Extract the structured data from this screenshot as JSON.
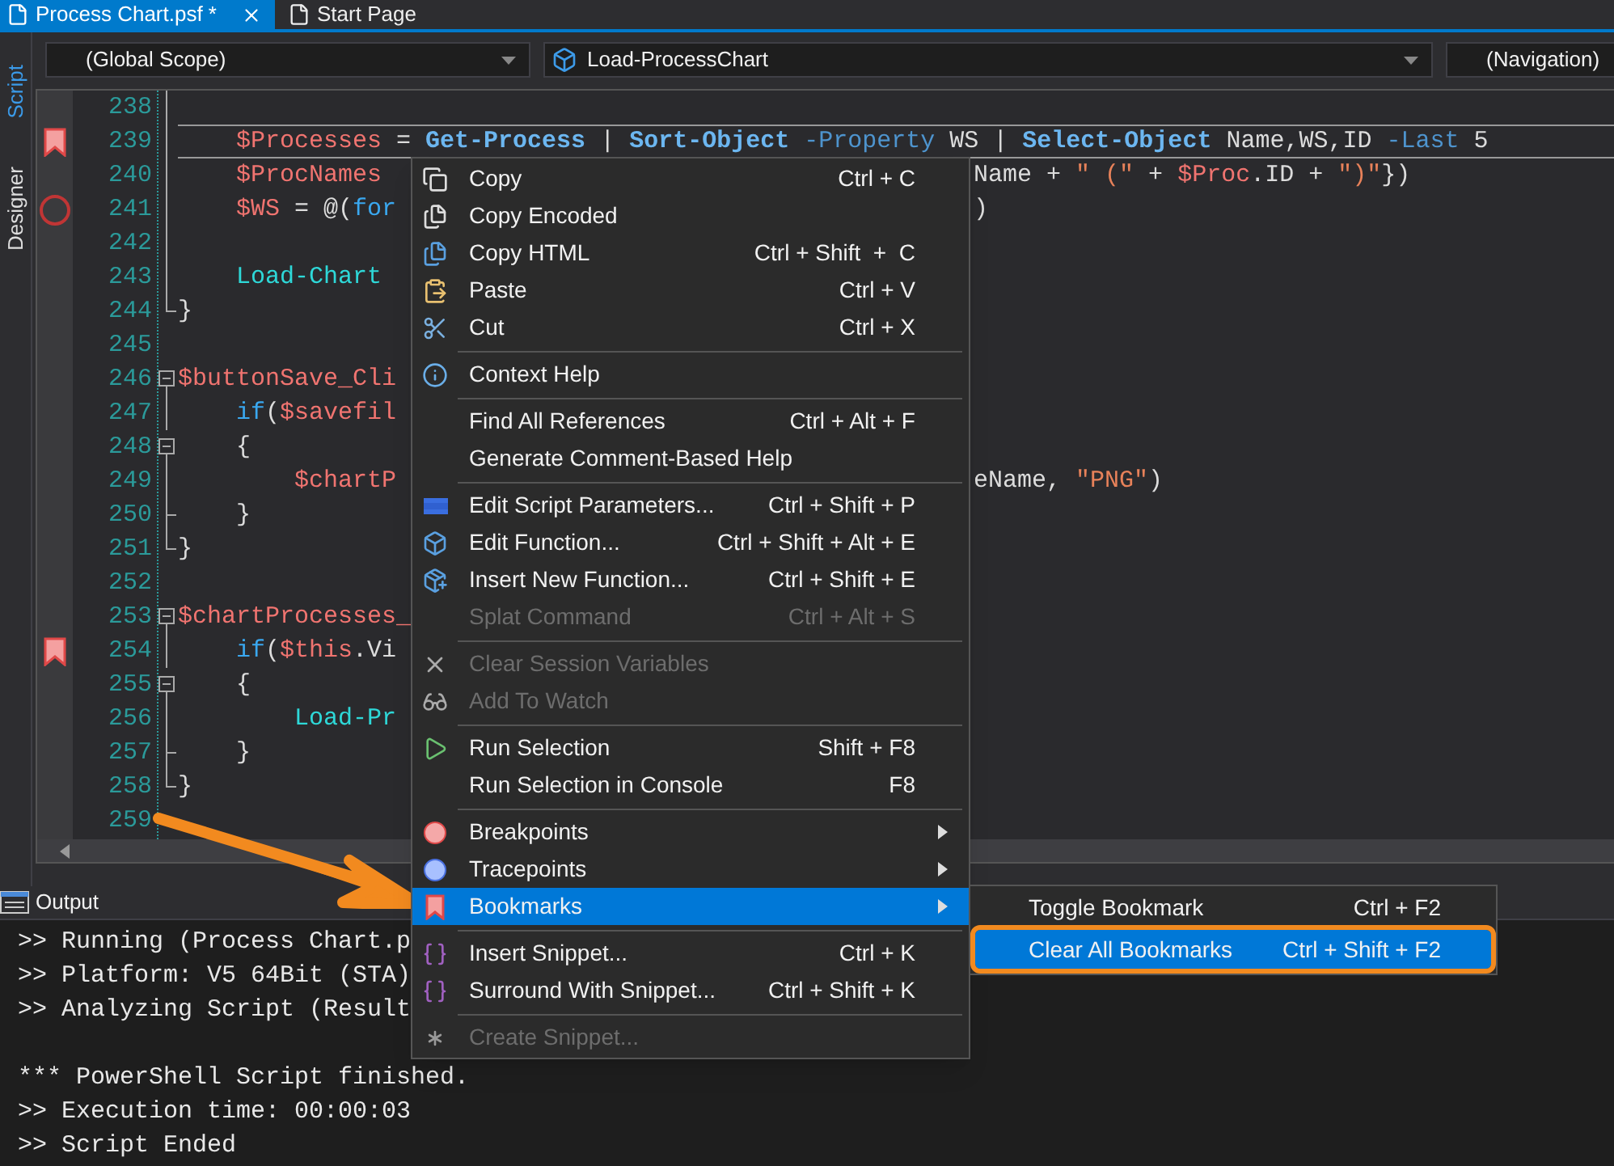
{
  "tabs": [
    {
      "label": "Process Chart.psf *",
      "selected": true,
      "closable": true
    },
    {
      "label": "Start Page",
      "selected": false,
      "closable": false
    }
  ],
  "side_tabs": [
    {
      "label": "Script",
      "selected": true
    },
    {
      "label": "Designer",
      "selected": false
    }
  ],
  "dropdowns": [
    {
      "kind": "scope",
      "value": "(Global Scope)"
    },
    {
      "kind": "member",
      "value": "Load-ProcessChart"
    },
    {
      "kind": "navigation",
      "value": "(Navigation)"
    }
  ],
  "editor": {
    "lines": [
      {
        "number": "238",
        "kind": "inner",
        "current": false,
        "bookmark": false,
        "breakpoint": false
      },
      {
        "number": "239",
        "kind": "inner",
        "current": true,
        "bookmark": true,
        "breakpoint": false,
        "code": [
          {
            "kind": "var",
            "text": "    $Processes"
          },
          {
            "kind": "op",
            "text": " = "
          },
          {
            "kind": "cmd",
            "text": "Get-Process"
          },
          {
            "kind": "op",
            "text": " | "
          },
          {
            "kind": "cmd",
            "text": "Sort-Object"
          },
          {
            "kind": "param",
            "text": " -Property"
          },
          {
            "kind": "plain",
            "text": " WS "
          },
          {
            "kind": "op",
            "text": "| "
          },
          {
            "kind": "cmd",
            "text": "Select-Object"
          },
          {
            "kind": "plain",
            "text": " Name,WS,ID"
          },
          {
            "kind": "param",
            "text": " -Last"
          },
          {
            "kind": "plain",
            "text": " 5"
          }
        ]
      },
      {
        "number": "240",
        "kind": "inner",
        "current": false,
        "bookmark": false,
        "breakpoint": false,
        "code": [
          {
            "kind": "var",
            "text": "    $ProcNames"
          }
        ],
        "code_right": [
          {
            "kind": "plain",
            "text": "Name"
          },
          {
            "kind": "op",
            "text": " + "
          },
          {
            "kind": "str",
            "text": "\" (\""
          },
          {
            "kind": "op",
            "text": " + "
          },
          {
            "kind": "var",
            "text": "$Proc"
          },
          {
            "kind": "plain",
            "text": ".ID"
          },
          {
            "kind": "op",
            "text": " + "
          },
          {
            "kind": "str",
            "text": "\")\""
          },
          {
            "kind": "plain",
            "text": "})"
          }
        ]
      },
      {
        "number": "241",
        "kind": "inner",
        "current": false,
        "bookmark": false,
        "breakpoint": true,
        "code": [
          {
            "kind": "var",
            "text": "    $WS"
          },
          {
            "kind": "op",
            "text": " = "
          },
          {
            "kind": "plain",
            "text": "@("
          },
          {
            "kind": "kw",
            "text": "for"
          }
        ],
        "code_right": [
          {
            "kind": "plain",
            "text": ")"
          }
        ]
      },
      {
        "number": "242",
        "kind": "inner",
        "current": false,
        "bookmark": false,
        "breakpoint": false
      },
      {
        "number": "243",
        "kind": "inner",
        "current": false,
        "bookmark": false,
        "breakpoint": false,
        "code": [
          {
            "kind": "cmdlet",
            "text": "    Load-Chart"
          }
        ]
      },
      {
        "number": "244",
        "kind": "end",
        "current": false,
        "bookmark": false,
        "breakpoint": false,
        "code": [
          {
            "kind": "plain",
            "text": "}"
          }
        ]
      },
      {
        "number": "245",
        "kind": "plain",
        "current": false,
        "bookmark": false,
        "breakpoint": false
      },
      {
        "number": "246",
        "kind": "open",
        "current": false,
        "bookmark": false,
        "breakpoint": false,
        "code": [
          {
            "kind": "var",
            "text": "$buttonSave_Cli"
          }
        ]
      },
      {
        "number": "247",
        "kind": "inner",
        "current": false,
        "bookmark": false,
        "breakpoint": false,
        "code": [
          {
            "kind": "kw",
            "text": "    if"
          },
          {
            "kind": "plain",
            "text": "("
          },
          {
            "kind": "var",
            "text": "$savefil"
          }
        ]
      },
      {
        "number": "248",
        "kind": "open",
        "current": false,
        "bookmark": false,
        "breakpoint": false,
        "code": [
          {
            "kind": "plain",
            "text": "    {"
          }
        ]
      },
      {
        "number": "249",
        "kind": "inner",
        "current": false,
        "bookmark": false,
        "breakpoint": false,
        "code": [
          {
            "kind": "var",
            "text": "        $chartP"
          }
        ],
        "code_right": [
          {
            "kind": "plain",
            "text": "eName, "
          },
          {
            "kind": "str",
            "text": "\"PNG\""
          },
          {
            "kind": "plain",
            "text": ")"
          }
        ]
      },
      {
        "number": "250",
        "kind": "tick",
        "current": false,
        "bookmark": false,
        "breakpoint": false,
        "code": [
          {
            "kind": "plain",
            "text": "    }"
          }
        ]
      },
      {
        "number": "251",
        "kind": "end",
        "current": false,
        "bookmark": false,
        "breakpoint": false,
        "code": [
          {
            "kind": "plain",
            "text": "}"
          }
        ]
      },
      {
        "number": "252",
        "kind": "plain",
        "current": false,
        "bookmark": false,
        "breakpoint": false
      },
      {
        "number": "253",
        "kind": "open",
        "current": false,
        "bookmark": false,
        "breakpoint": false,
        "code": [
          {
            "kind": "var",
            "text": "$chartProcesses_"
          }
        ]
      },
      {
        "number": "254",
        "kind": "inner",
        "current": false,
        "bookmark": true,
        "breakpoint": false,
        "code": [
          {
            "kind": "kw",
            "text": "    if"
          },
          {
            "kind": "plain",
            "text": "("
          },
          {
            "kind": "var",
            "text": "$this"
          },
          {
            "kind": "plain",
            "text": ".Vi"
          }
        ]
      },
      {
        "number": "255",
        "kind": "open",
        "current": false,
        "bookmark": false,
        "breakpoint": false,
        "code": [
          {
            "kind": "plain",
            "text": "    {"
          }
        ]
      },
      {
        "number": "256",
        "kind": "inner",
        "current": false,
        "bookmark": false,
        "breakpoint": false,
        "code": [
          {
            "kind": "cmdlet",
            "text": "        Load-Pr"
          }
        ]
      },
      {
        "number": "257",
        "kind": "tick",
        "current": false,
        "bookmark": false,
        "breakpoint": false,
        "code": [
          {
            "kind": "plain",
            "text": "    }"
          }
        ]
      },
      {
        "number": "258",
        "kind": "end",
        "current": false,
        "bookmark": false,
        "breakpoint": false,
        "code": [
          {
            "kind": "plain",
            "text": "}"
          }
        ]
      },
      {
        "number": "259",
        "kind": "plain",
        "current": false,
        "bookmark": false,
        "breakpoint": false
      }
    ]
  },
  "output": {
    "title": "Output",
    "blocks": [
      [
        ">> Running (Process Chart.p",
        ">> Platform: V5 64Bit (STA)",
        ">> Analyzing Script (Result"
      ],
      [
        "*** PowerShell Script finished.",
        ">> Execution time: 00:00:03",
        ">> Script Ended"
      ]
    ]
  },
  "menu": {
    "items": [
      {
        "kind": "item",
        "label": "Copy",
        "shortcut": "Ctrl + C",
        "disabled": false,
        "selected": false,
        "submenu": false
      },
      {
        "kind": "item",
        "label": "Copy Encoded",
        "disabled": false,
        "selected": false,
        "submenu": false
      },
      {
        "kind": "item",
        "label": "Copy HTML",
        "shortcut": "Ctrl + Shift  +  C",
        "disabled": false,
        "selected": false,
        "submenu": false
      },
      {
        "kind": "item",
        "label": "Paste",
        "shortcut": "Ctrl + V",
        "disabled": false,
        "selected": false,
        "submenu": false
      },
      {
        "kind": "item",
        "label": "Cut",
        "shortcut": "Ctrl + X",
        "disabled": false,
        "selected": false,
        "submenu": false
      },
      {
        "kind": "separator"
      },
      {
        "kind": "item",
        "label": "Context Help",
        "disabled": false,
        "selected": false,
        "submenu": false
      },
      {
        "kind": "separator"
      },
      {
        "kind": "item",
        "label": "Find All References",
        "shortcut": "Ctrl + Alt + F",
        "disabled": false,
        "selected": false,
        "submenu": false
      },
      {
        "kind": "item",
        "label": "Generate Comment-Based Help",
        "disabled": false,
        "selected": false,
        "submenu": false
      },
      {
        "kind": "separator"
      },
      {
        "kind": "item",
        "label": "Edit Script Parameters...",
        "shortcut": "Ctrl + Shift + P",
        "disabled": false,
        "selected": false,
        "submenu": false
      },
      {
        "kind": "item",
        "label": "Edit Function...",
        "shortcut": "Ctrl + Shift + Alt + E",
        "disabled": false,
        "selected": false,
        "submenu": false
      },
      {
        "kind": "item",
        "label": "Insert New Function...",
        "shortcut": "Ctrl + Shift + E",
        "disabled": false,
        "selected": false,
        "submenu": false
      },
      {
        "kind": "item",
        "label": "Splat Command",
        "shortcut": "Ctrl + Alt + S",
        "disabled": true,
        "selected": false,
        "submenu": false
      },
      {
        "kind": "separator"
      },
      {
        "kind": "item",
        "label": "Clear Session Variables",
        "disabled": true,
        "selected": false,
        "submenu": false
      },
      {
        "kind": "item",
        "label": "Add To Watch",
        "disabled": true,
        "selected": false,
        "submenu": false
      },
      {
        "kind": "separator"
      },
      {
        "kind": "item",
        "label": "Run Selection",
        "shortcut": "Shift + F8",
        "disabled": false,
        "selected": false,
        "submenu": false
      },
      {
        "kind": "item",
        "label": "Run Selection in Console",
        "shortcut": "F8",
        "disabled": false,
        "selected": false,
        "submenu": false
      },
      {
        "kind": "separator"
      },
      {
        "kind": "item",
        "label": "Breakpoints",
        "disabled": false,
        "selected": false,
        "submenu": true
      },
      {
        "kind": "item",
        "label": "Tracepoints",
        "disabled": false,
        "selected": false,
        "submenu": true
      },
      {
        "kind": "item",
        "label": "Bookmarks",
        "disabled": false,
        "selected": true,
        "submenu": true,
        "submenu_items": [
          {
            "label": "Toggle Bookmark",
            "shortcut": "Ctrl + F2",
            "selected": false,
            "callout": false
          },
          {
            "label": "Clear All Bookmarks",
            "shortcut": "Ctrl + Shift + F2",
            "selected": true,
            "callout": true
          }
        ]
      },
      {
        "kind": "separator"
      },
      {
        "kind": "item",
        "label": "Insert Snippet...",
        "shortcut": "Ctrl + K",
        "disabled": false,
        "selected": false,
        "submenu": false
      },
      {
        "kind": "item",
        "label": "Surround With Snippet...",
        "shortcut": "Ctrl + Shift + K",
        "disabled": false,
        "selected": false,
        "submenu": false
      },
      {
        "kind": "separator"
      },
      {
        "kind": "item",
        "label": "Create Snippet...",
        "disabled": true,
        "selected": false,
        "submenu": false
      }
    ]
  }
}
